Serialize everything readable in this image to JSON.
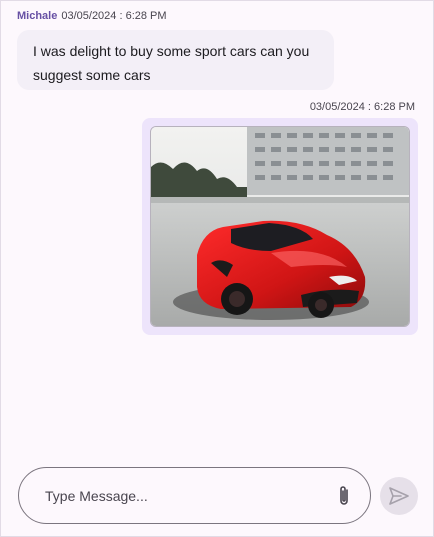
{
  "messages": [
    {
      "author": "Michale",
      "timestamp": "03/05/2024 : 6:28 PM",
      "text": "I was delight to buy some sport cars can you suggest some cars"
    },
    {
      "timestamp": "03/05/2024 : 6:28 PM",
      "attachment": "image"
    }
  ],
  "composer": {
    "placeholder": "Type Message...",
    "attach_icon": "paperclip-icon",
    "send_icon": "send-icon"
  },
  "colors": {
    "author": "#6750a4",
    "incoming_bubble": "#f3eff7",
    "outgoing_bubble": "#ede4fb",
    "car": "#d01515"
  }
}
